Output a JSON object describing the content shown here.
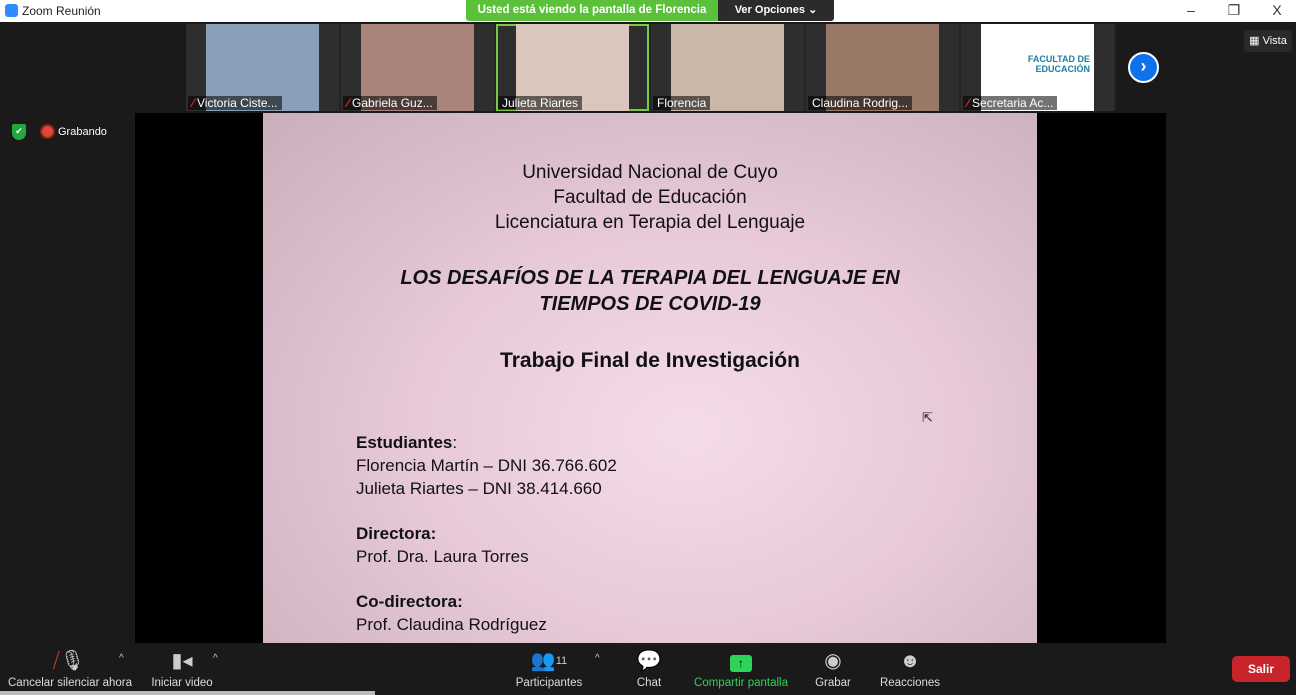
{
  "window": {
    "title": "Zoom Reunión",
    "minimize": "–",
    "restore": "❐",
    "close": "X"
  },
  "banner": {
    "text": "Usted está viendo la pantalla de Florencia",
    "options_label": "Ver Opciones ⌄"
  },
  "participants": [
    {
      "name": "Victoria Ciste...",
      "muted": true,
      "color": "#8aa0b8"
    },
    {
      "name": "Gabriela Guz...",
      "muted": true,
      "color": "#a8847a"
    },
    {
      "name": "Julieta Riartes",
      "muted": false,
      "active": true,
      "color": "#d9c7bd"
    },
    {
      "name": "Florencia",
      "muted": false,
      "color": "#c9b7a8"
    },
    {
      "name": "Claudina Rodrig...",
      "muted": false,
      "color": "#9a7868"
    },
    {
      "name": "Secretaria Ac...",
      "muted": true,
      "color": "#ffffff"
    }
  ],
  "logo_text": "FACULTAD DE EDUCACIÓN",
  "next_icon": "chevron-right-icon",
  "view_label": "Vista",
  "recording_label": "Grabando",
  "slide": {
    "header": [
      "Universidad Nacional de Cuyo",
      "Facultad de Educación",
      "Licenciatura en Terapia del Lenguaje"
    ],
    "title": [
      "LOS DESAFÍOS DE LA TERAPIA DEL LENGUAJE EN",
      "TIEMPOS DE COVID-19"
    ],
    "subtitle": "Trabajo Final de Investigación",
    "students_label": "Estudiantes",
    "students": [
      "Florencia Martín – DNI 36.766.602",
      "Julieta Riartes – DNI 38.414.660"
    ],
    "director_label": "Directora:",
    "director": "Prof. Dra. Laura Torres",
    "codirector_label": "Co-directora:",
    "codirector": "Prof. Claudina Rodríguez"
  },
  "toolbar": {
    "mute": "Cancelar silenciar ahora",
    "video": "Iniciar video",
    "participants": "Participantes",
    "participants_count": "11",
    "chat": "Chat",
    "share": "Compartir pantalla",
    "record": "Grabar",
    "reactions": "Reacciones",
    "leave": "Salir"
  },
  "colors": {
    "accent": "#0e72ed",
    "share_green": "#2ed35a",
    "leave_red": "#c8242b",
    "banner_green": "#5cc13a"
  }
}
